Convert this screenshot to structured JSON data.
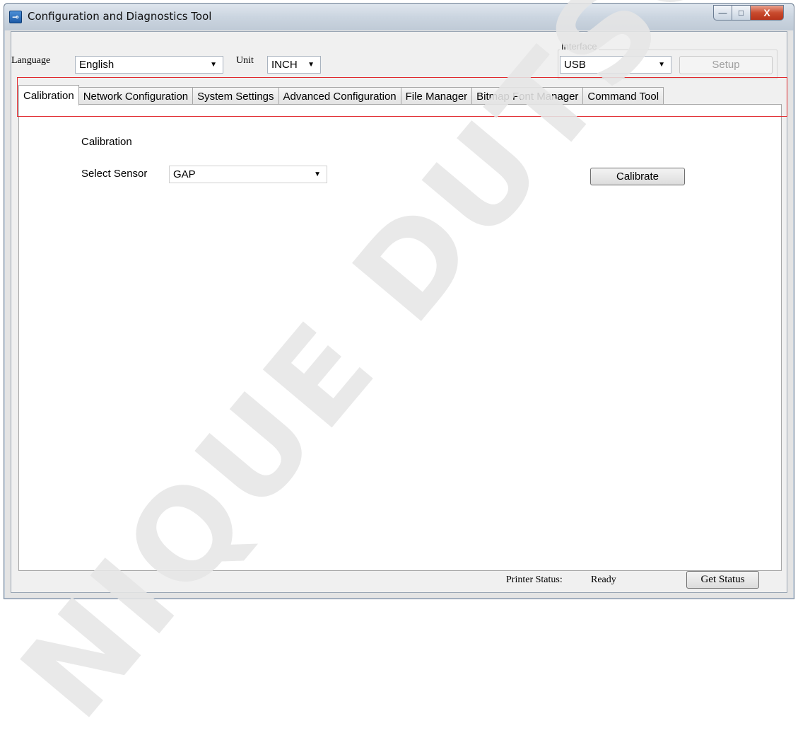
{
  "window": {
    "title": "Configuration and Diagnostics Tool",
    "icon": "app-icon",
    "controls": {
      "minimize": "—",
      "maximize": "□",
      "close": "X"
    }
  },
  "toolbar": {
    "language_label": "Language",
    "language_value": "English",
    "unit_label": "Unit",
    "unit_value": "INCH",
    "interface_label": "Interface",
    "interface_value": "USB",
    "setup_label": "Setup"
  },
  "tabs": [
    {
      "label": "Calibration",
      "active": true
    },
    {
      "label": "Network Configuration"
    },
    {
      "label": "System Settings"
    },
    {
      "label": "Advanced Configuration"
    },
    {
      "label": "File Manager"
    },
    {
      "label": "Bitmap Font Manager"
    },
    {
      "label": "Command Tool"
    }
  ],
  "calibration": {
    "heading": "Calibration",
    "sensor_label": "Select Sensor",
    "sensor_value": "GAP",
    "calibrate_label": "Calibrate"
  },
  "status": {
    "printer_status_label": "Printer Status:",
    "printer_status_value": "Ready",
    "get_status_label": "Get Status"
  },
  "watermark": "NIQUE DUTSCH",
  "colors": {
    "highlight": "#e0282d",
    "title_bar": "#cbd5e0"
  }
}
